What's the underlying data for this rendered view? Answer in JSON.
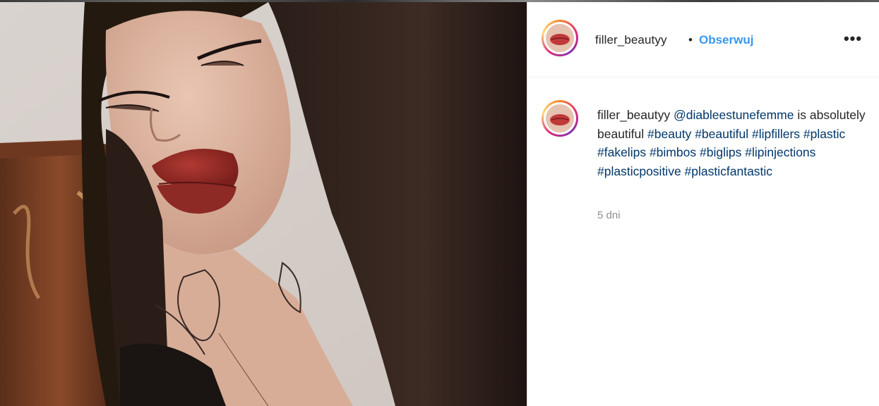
{
  "post": {
    "image_alt": "Selfie photo",
    "author": "filler_beautyy",
    "follow_label": "Obserwuj",
    "separator": "•",
    "more_icon": "more-options-icon"
  },
  "caption": {
    "author": "filler_beautyy",
    "segments": [
      {
        "type": "mention",
        "text": "@diableestunefemme"
      },
      {
        "type": "text",
        "text": " is absolutely beautiful "
      },
      {
        "type": "tag",
        "text": "#beauty"
      },
      {
        "type": "text",
        "text": " "
      },
      {
        "type": "tag",
        "text": "#beautiful"
      },
      {
        "type": "text",
        "text": " "
      },
      {
        "type": "tag",
        "text": "#lipfillers"
      },
      {
        "type": "text",
        "text": " "
      },
      {
        "type": "tag",
        "text": "#plastic"
      },
      {
        "type": "text",
        "text": " "
      },
      {
        "type": "tag",
        "text": "#fakelips"
      },
      {
        "type": "text",
        "text": " "
      },
      {
        "type": "tag",
        "text": "#bimbos"
      },
      {
        "type": "text",
        "text": " "
      },
      {
        "type": "tag",
        "text": "#biglips"
      },
      {
        "type": "text",
        "text": " "
      },
      {
        "type": "tag",
        "text": "#lipinjections"
      },
      {
        "type": "text",
        "text": " "
      },
      {
        "type": "tag",
        "text": "#plasticpositive"
      },
      {
        "type": "text",
        "text": " "
      },
      {
        "type": "tag",
        "text": "#plasticfantastic"
      }
    ],
    "timestamp": "5 dni"
  },
  "colors": {
    "link": "#00376b",
    "follow": "#3897f0",
    "muted": "#8e8e8e"
  }
}
